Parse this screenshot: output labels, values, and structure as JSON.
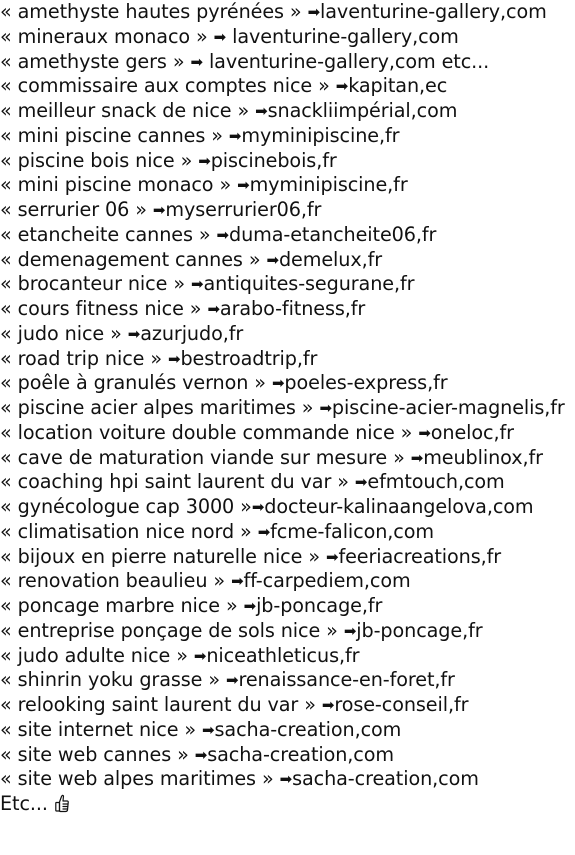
{
  "entries": [
    {
      "keyword": "amethyste hautes pyrénées",
      "space_before_arrow": true,
      "space_after_arrow": false,
      "site": "laventurine-gallery,com",
      "suffix": ""
    },
    {
      "keyword": "mineraux monaco",
      "space_before_arrow": true,
      "space_after_arrow": true,
      "site": "laventurine-gallery,com",
      "suffix": ""
    },
    {
      "keyword": "amethyste gers",
      "space_before_arrow": true,
      "space_after_arrow": true,
      "site": "laventurine-gallery,com",
      "suffix": " etc..."
    },
    {
      "keyword": "commissaire aux comptes nice",
      "space_before_arrow": true,
      "space_after_arrow": false,
      "site": "kapitan,ec",
      "suffix": ""
    },
    {
      "keyword": "meilleur snack de nice",
      "space_before_arrow": true,
      "space_after_arrow": false,
      "site": "snackliimpérial,com",
      "suffix": ""
    },
    {
      "keyword": "mini piscine cannes",
      "space_before_arrow": true,
      "space_after_arrow": false,
      "site": "myminipiscine,fr",
      "suffix": ""
    },
    {
      "keyword": "piscine bois nice",
      "space_before_arrow": true,
      "space_after_arrow": false,
      "site": "piscinebois,fr",
      "suffix": ""
    },
    {
      "keyword": "mini piscine monaco",
      "space_before_arrow": true,
      "space_after_arrow": false,
      "site": "myminipiscine,fr",
      "suffix": ""
    },
    {
      "keyword": "serrurier 06",
      "space_before_arrow": true,
      "space_after_arrow": false,
      "site": "myserrurier06,fr",
      "suffix": ""
    },
    {
      "keyword": "etancheite cannes",
      "space_before_arrow": true,
      "space_after_arrow": false,
      "site": "duma-etancheite06,fr",
      "suffix": ""
    },
    {
      "keyword": "demenagement cannes",
      "space_before_arrow": true,
      "space_after_arrow": false,
      "site": "demelux,fr",
      "suffix": ""
    },
    {
      "keyword": "brocanteur nice",
      "space_before_arrow": true,
      "space_after_arrow": false,
      "site": "antiquites-segurane,fr",
      "suffix": ""
    },
    {
      "keyword": "cours fitness nice",
      "space_before_arrow": true,
      "space_after_arrow": false,
      "site": "arabo-fitness,fr",
      "suffix": ""
    },
    {
      "keyword": "judo nice",
      "space_before_arrow": true,
      "space_after_arrow": false,
      "site": "azurjudo,fr",
      "suffix": ""
    },
    {
      "keyword": "road trip nice",
      "space_before_arrow": true,
      "space_after_arrow": false,
      "site": "bestroadtrip,fr",
      "suffix": ""
    },
    {
      "keyword": "poêle à granulés vernon",
      "space_before_arrow": true,
      "space_after_arrow": false,
      "site": "poeles-express,fr",
      "suffix": ""
    },
    {
      "keyword": "piscine acier alpes maritimes",
      "space_before_arrow": true,
      "space_after_arrow": false,
      "site": "piscine-acier-magnelis,fr",
      "suffix": ""
    },
    {
      "keyword": "location voiture double commande nice",
      "space_before_arrow": true,
      "space_after_arrow": false,
      "site": "oneloc,fr",
      "suffix": ""
    },
    {
      "keyword": "cave de maturation viande sur mesure",
      "space_before_arrow": true,
      "space_after_arrow": false,
      "site": "meublinox,fr",
      "suffix": ""
    },
    {
      "keyword": "coaching hpi saint laurent du var",
      "space_before_arrow": true,
      "space_after_arrow": false,
      "site": "efmtouch,com",
      "suffix": ""
    },
    {
      "keyword": "gynécologue cap 3000",
      "space_before_arrow": false,
      "space_after_arrow": false,
      "site": "docteur-kalinaangelova,com",
      "suffix": ""
    },
    {
      "keyword": "climatisation nice nord",
      "space_before_arrow": true,
      "space_after_arrow": false,
      "site": "fcme-falicon,com",
      "suffix": ""
    },
    {
      "keyword": "bijoux en pierre naturelle nice",
      "space_before_arrow": true,
      "space_after_arrow": false,
      "site": "feeriacreations,fr",
      "suffix": ""
    },
    {
      "keyword": "renovation beaulieu",
      "space_before_arrow": true,
      "space_after_arrow": false,
      "site": "ff-carpediem,com",
      "suffix": ""
    },
    {
      "keyword": "poncage marbre nice",
      "space_before_arrow": true,
      "space_after_arrow": false,
      "site": "jb-poncage,fr",
      "suffix": ""
    },
    {
      "keyword": "entreprise ponçage de sols nice",
      "space_before_arrow": true,
      "space_after_arrow": false,
      "site": "jb-poncage,fr",
      "suffix": ""
    },
    {
      "keyword": "judo adulte nice",
      "space_before_arrow": true,
      "space_after_arrow": false,
      "site": "niceathleticus,fr",
      "suffix": ""
    },
    {
      "keyword": "shinrin yoku grasse",
      "space_before_arrow": true,
      "space_after_arrow": false,
      "site": "renaissance-en-foret,fr",
      "suffix": ""
    },
    {
      "keyword": "relooking saint laurent du var",
      "space_before_arrow": true,
      "space_after_arrow": false,
      "site": "rose-conseil,fr",
      "suffix": ""
    },
    {
      "keyword": "site internet nice",
      "space_before_arrow": true,
      "space_after_arrow": false,
      "site": "sacha-creation,com",
      "suffix": ""
    },
    {
      "keyword": "site web cannes",
      "space_before_arrow": true,
      "space_after_arrow": false,
      "site": "sacha-creation,com",
      "suffix": ""
    },
    {
      "keyword": "site web alpes maritimes",
      "space_before_arrow": true,
      "space_after_arrow": false,
      "site": "sacha-creation,com",
      "suffix": ""
    }
  ],
  "symbols": {
    "open_quote": "« ",
    "close_quote": " »",
    "arrow": "➡",
    "arrow_icon_name": "right-arrow-icon",
    "closing_icon_name": "thumbs-up-icon"
  },
  "footer": {
    "text": "Etc..."
  },
  "colors": {
    "text": "#111111",
    "background": "#ffffff"
  }
}
